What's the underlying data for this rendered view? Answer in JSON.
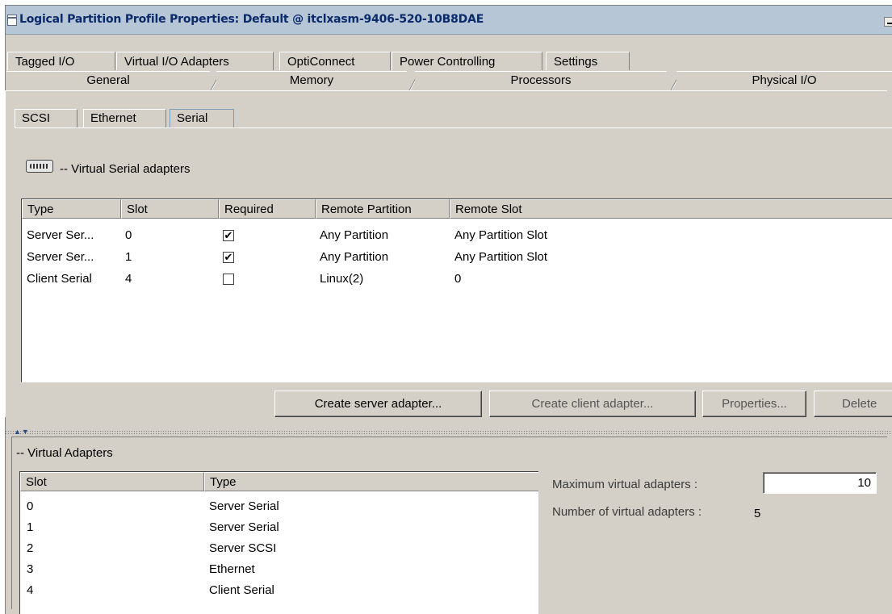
{
  "window": {
    "title": "Logical Partition Profile Properties: Default @ itclxasm-9406-520-10B8DAE"
  },
  "tabs_back_row": [
    "Tagged I/O",
    "Virtual I/O Adapters",
    "OptiConnect",
    "Power Controlling",
    "Settings"
  ],
  "tabs_front_row": [
    "General",
    "Memory",
    "Processors",
    "Physical I/O"
  ],
  "sub_tabs": [
    "SCSI",
    "Ethernet",
    "Serial"
  ],
  "selected_sub_tab": "Serial",
  "serial_section": {
    "icon": "serial-port-icon",
    "label": "-- Virtual Serial adapters",
    "columns": [
      "Type",
      "Slot",
      "Required",
      "Remote Partition",
      "Remote Slot"
    ],
    "rows": [
      {
        "type": "Server Ser...",
        "slot": "0",
        "required": true,
        "remote_partition": "Any Partition",
        "remote_slot": "Any Partition Slot"
      },
      {
        "type": "Server Ser...",
        "slot": "1",
        "required": true,
        "remote_partition": "Any Partition",
        "remote_slot": "Any Partition Slot"
      },
      {
        "type": "Client Serial",
        "slot": "4",
        "required": false,
        "remote_partition": "Linux(2)",
        "remote_slot": "0"
      }
    ],
    "buttons": {
      "create_server": "Create server adapter...",
      "create_client": "Create client adapter...",
      "properties": "Properties...",
      "delete": "Delete"
    }
  },
  "virtual_adapters": {
    "label": "-- Virtual Adapters",
    "columns": [
      "Slot",
      "Type"
    ],
    "rows": [
      {
        "slot": "0",
        "type": "Server Serial"
      },
      {
        "slot": "1",
        "type": "Server Serial"
      },
      {
        "slot": "2",
        "type": "Server SCSI"
      },
      {
        "slot": "3",
        "type": "Ethernet"
      },
      {
        "slot": "4",
        "type": "Client Serial"
      }
    ],
    "max_label": "Maximum virtual adapters :",
    "max_value": "10",
    "count_label": "Number of virtual adapters :",
    "count_value": "5"
  }
}
